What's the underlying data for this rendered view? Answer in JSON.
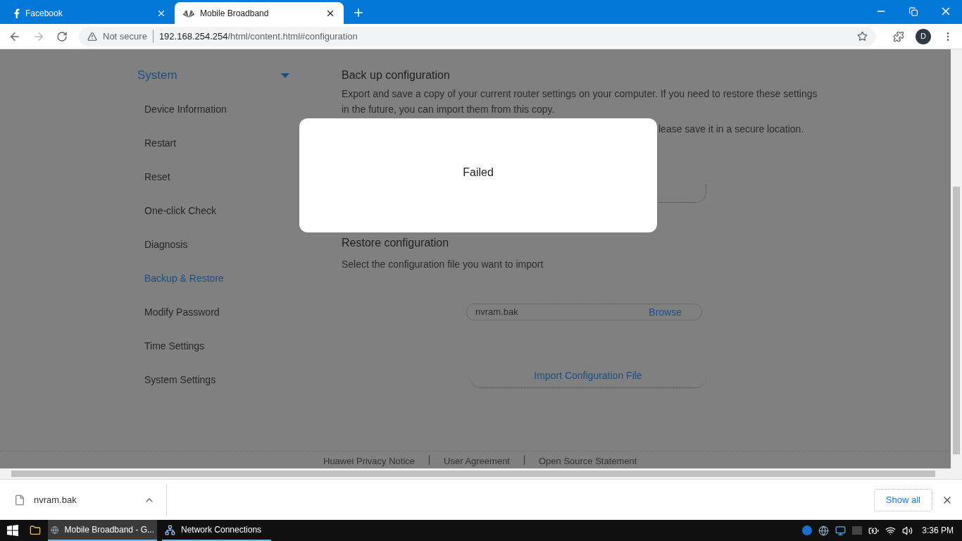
{
  "browser": {
    "tabs": [
      {
        "title": "Facebook",
        "selected": false
      },
      {
        "title": "Mobile Broadband",
        "selected": true
      }
    ],
    "address": {
      "security": "Not secure",
      "host": "192.168.254.254",
      "path": "/html/content.html#configuration"
    },
    "profile": "D"
  },
  "sidebar": {
    "section": "System",
    "expanded": true,
    "items": [
      {
        "label": "Device Information",
        "selected": false
      },
      {
        "label": "Restart",
        "selected": false
      },
      {
        "label": "Reset",
        "selected": false
      },
      {
        "label": "One-click Check",
        "selected": false
      },
      {
        "label": "Diagnosis",
        "selected": false
      },
      {
        "label": "Backup & Restore",
        "selected": true
      },
      {
        "label": "Modify Password",
        "selected": false
      },
      {
        "label": "Time Settings",
        "selected": false
      },
      {
        "label": "System Settings",
        "selected": false
      }
    ]
  },
  "backup": {
    "title": "Back up configuration",
    "description": "Export and save a copy of your current router settings on your computer. If you need to restore these settings in the future, you can import them from this copy.",
    "note_fragment": "lease save it in a secure location."
  },
  "restore": {
    "title": "Restore configuration",
    "description": "Select the configuration file you want to import",
    "file_field": {
      "value": "nvram.bak",
      "browse": "Browse"
    },
    "import_button": "Import Configuration File"
  },
  "footer_links": [
    "Huawei Privacy Notice",
    "User Agreement",
    "Open Source Statement"
  ],
  "dialog": {
    "message": "Failed"
  },
  "downloads": {
    "items": [
      {
        "name": "nvram.bak"
      }
    ],
    "show_all": "Show all"
  },
  "taskbar": {
    "apps": [
      {
        "label": "Mobile Broadband - G...",
        "selected": true
      },
      {
        "label": "Network Connections",
        "selected": false
      }
    ],
    "clock": "3:36 PM"
  }
}
